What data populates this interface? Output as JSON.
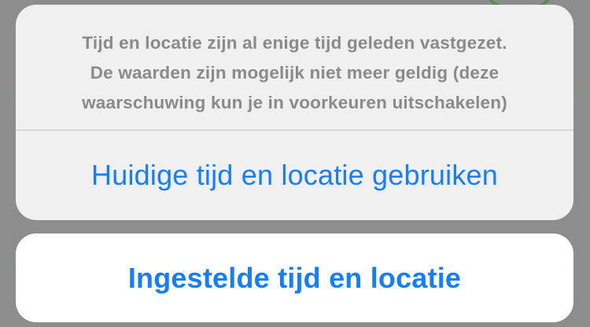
{
  "alert": {
    "message_lines": [
      "Tijd en locatie zijn al enige tijd geleden vastgezet.",
      "De waarden zijn mogelijk niet meer geldig (deze",
      "waarschuwing kun je in voorkeuren uitschakelen)"
    ],
    "actions": [
      {
        "label": "Huidige tijd en locatie gebruiken"
      }
    ],
    "cancel": {
      "label": "Ingestelde tijd en locatie"
    }
  },
  "colors": {
    "accent": "#147efb",
    "message_text": "#8a8a8a",
    "sheet_background": "#f0f0f0",
    "cancel_background": "#ffffff",
    "dimmed_backdrop": "#8d8d8d"
  }
}
